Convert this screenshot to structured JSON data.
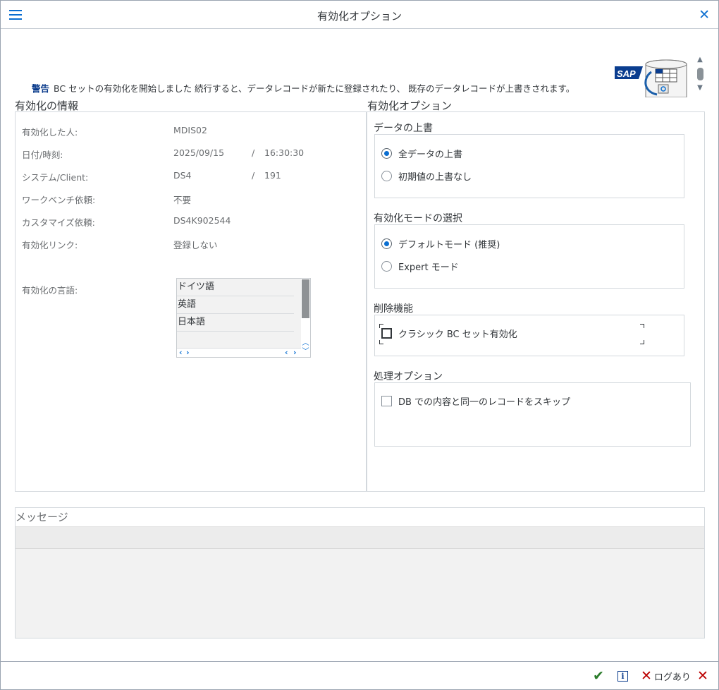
{
  "window": {
    "title": "有効化オプション"
  },
  "warning": {
    "label": "警告",
    "text": "BC セットの有効化を開始しました 続行すると、データレコードが新たに登録されたり、 既存のデータレコードが上書きされます。"
  },
  "logo": {
    "text": "SAP"
  },
  "info_section": {
    "title": "有効化の情報",
    "rows": [
      {
        "label": "有効化した人:",
        "value": "MDIS02"
      },
      {
        "label": "日付/時刻:",
        "value": "2025/09/15",
        "sep": "/",
        "value2": "16:30:30"
      },
      {
        "label": "システム/Client:",
        "value": "DS4",
        "sep": "/",
        "value2": "191"
      },
      {
        "label": "ワークベンチ依頼:",
        "value": "不要"
      },
      {
        "label": "カスタマイズ依頼:",
        "value": "DS4K902544"
      },
      {
        "label": "有効化リンク:",
        "value": "登録しない"
      }
    ],
    "languages_label": "有効化の言語:",
    "languages": [
      "ドイツ語",
      "英語",
      "日本語"
    ]
  },
  "options_section": {
    "title": "有効化オプション",
    "overwrite": {
      "title": "データの上書",
      "options": [
        {
          "label": "全データの上書",
          "selected": true
        },
        {
          "label": "初期値の上書なし",
          "selected": false
        }
      ]
    },
    "mode": {
      "title": "有効化モードの選択",
      "options": [
        {
          "label": "デフォルトモード (推奨)",
          "selected": true
        },
        {
          "label": "Expert モード",
          "selected": false
        }
      ]
    },
    "delete": {
      "title": "削除機能",
      "checkbox": {
        "label": "クラシック BC セット有効化",
        "checked": false
      }
    },
    "processing": {
      "title": "処理オプション",
      "checkbox": {
        "label": "DB での内容と同一のレコードをスキップ",
        "checked": false
      }
    }
  },
  "messages": {
    "title": "メッセージ"
  },
  "footer": {
    "log_label": "ログあり"
  },
  "colors": {
    "accent": "#0a6ed1",
    "warning_label": "#0b3c8c",
    "confirm": "#2b7c2b",
    "cancel": "#bb0000"
  },
  "icons": {
    "menu": "menu-icon",
    "close": "close-icon",
    "confirm": "check-icon",
    "info": "info-icon",
    "log": "x-icon",
    "cancel": "x-icon"
  }
}
